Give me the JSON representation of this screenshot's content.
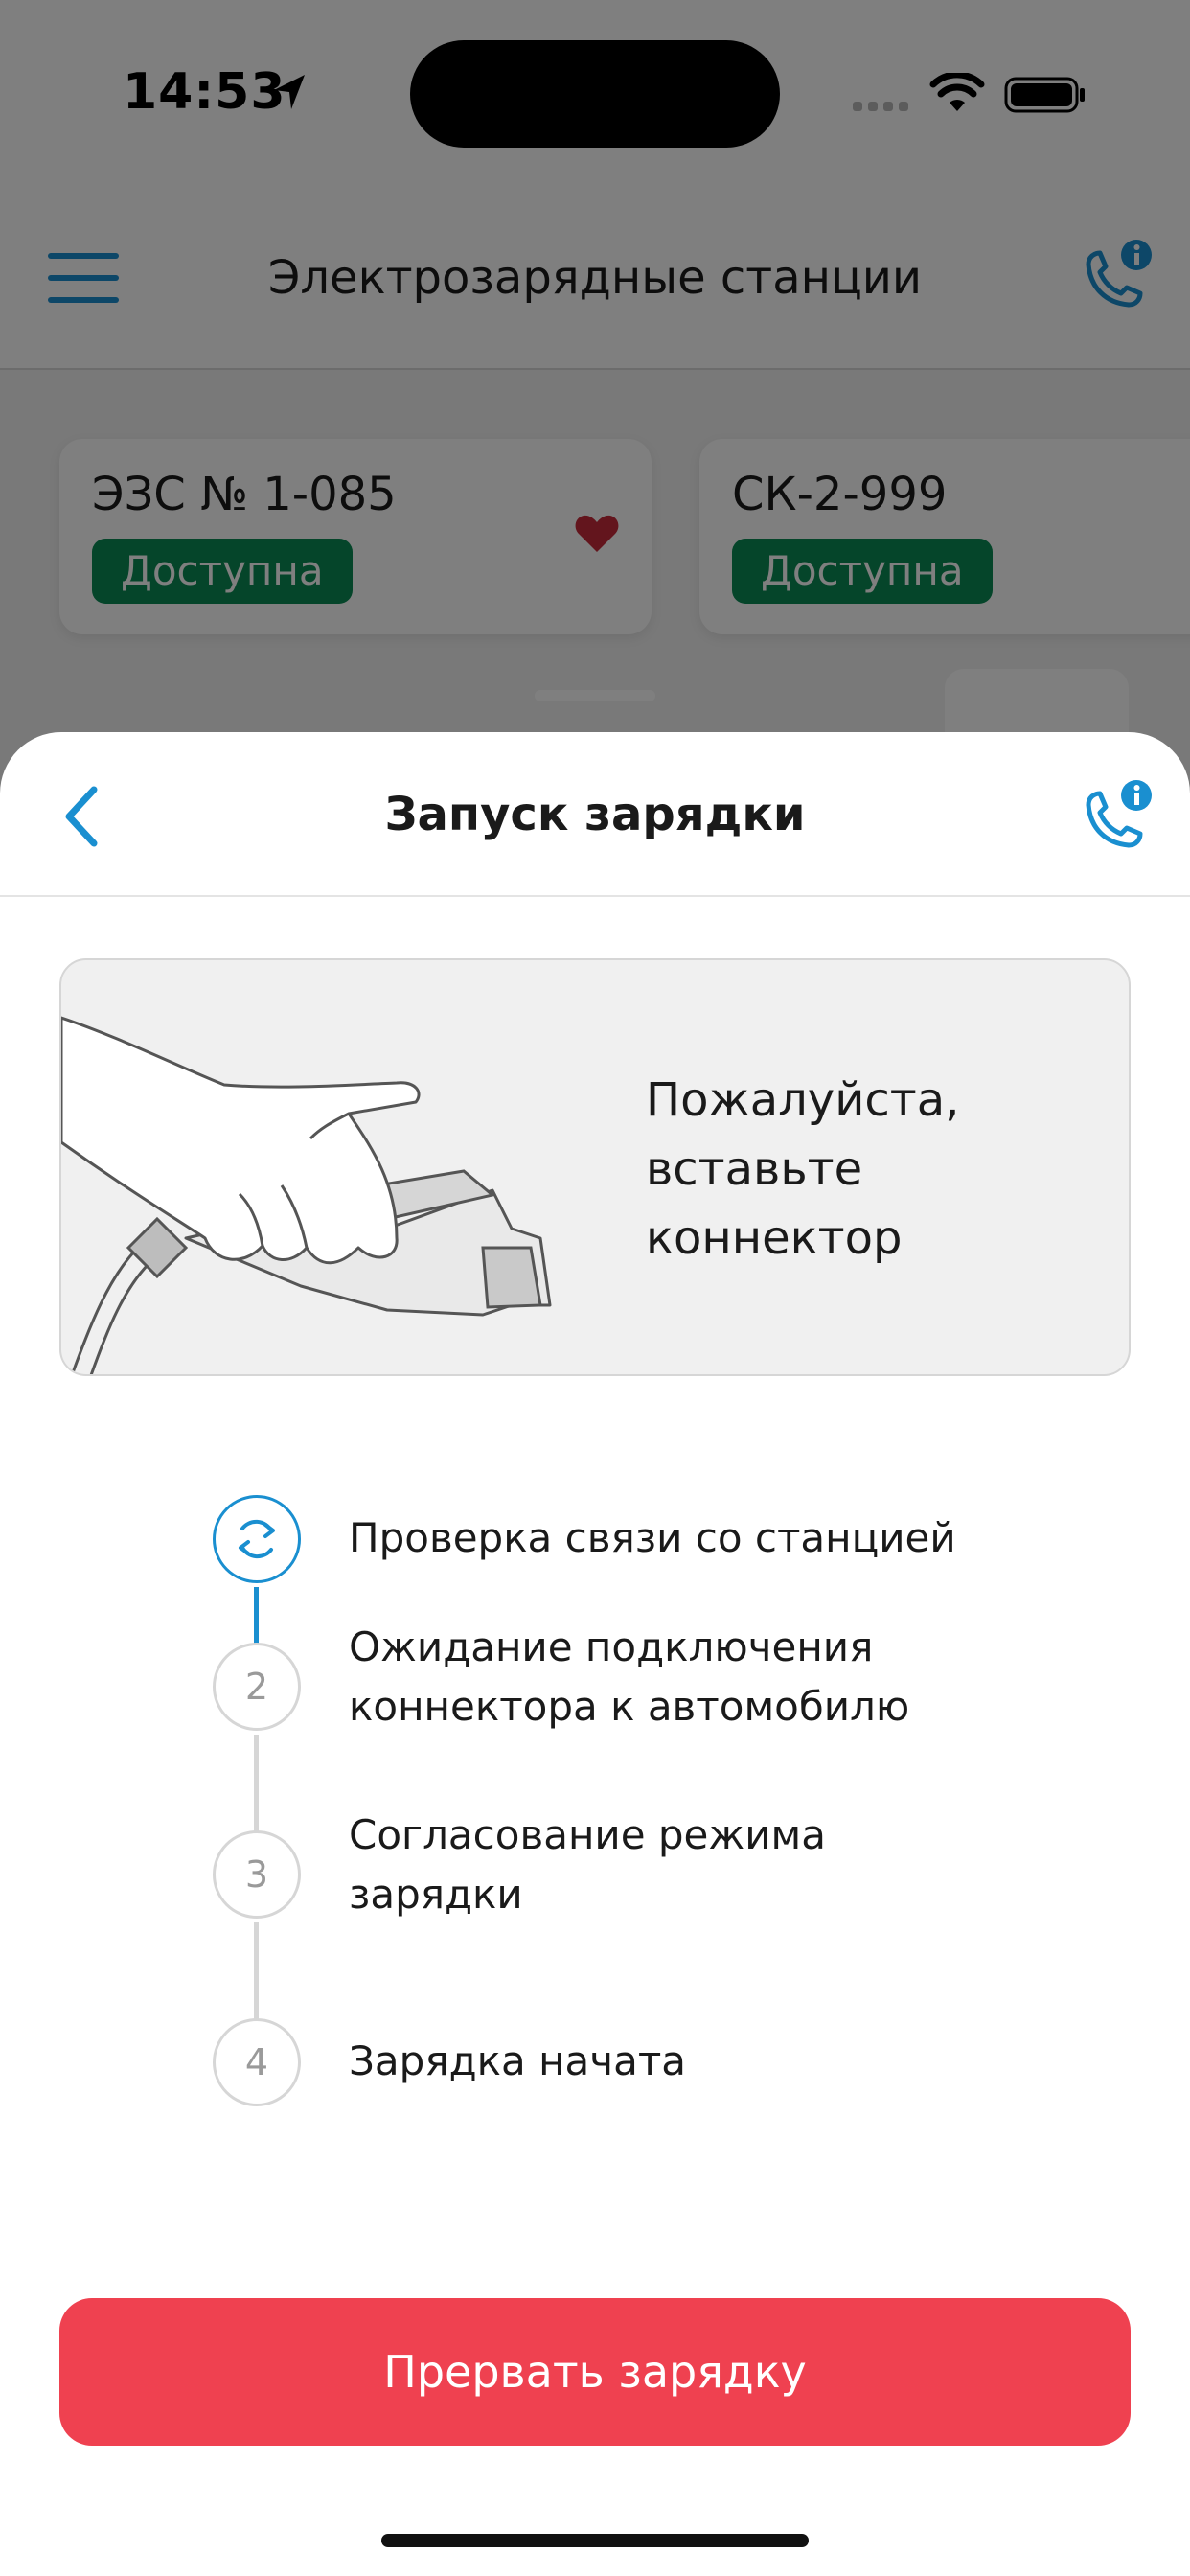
{
  "status_bar": {
    "time": "14:53"
  },
  "background_screen": {
    "header": {
      "title": "Электрозарядные станции"
    },
    "stations": [
      {
        "title": "ЭЗС № 1-085",
        "status": "Доступна",
        "favorite": true
      },
      {
        "title": "СК-2-999",
        "status": "Доступна",
        "favorite": false
      }
    ]
  },
  "sheet": {
    "title": "Запуск зарядки",
    "illustration_text": "Пожалуйста,\nвставьте\nконнектор",
    "steps": [
      {
        "number": "",
        "label": "Проверка связи со станцией",
        "state": "active",
        "icon": "refresh-icon"
      },
      {
        "number": "2",
        "label": "Ожидание подключения\nконнектора к автомобилю",
        "state": "pending"
      },
      {
        "number": "3",
        "label": "Согласование режима\nзарядки",
        "state": "pending"
      },
      {
        "number": "4",
        "label": "Зарядка начата",
        "state": "pending"
      }
    ],
    "stop_button_label": "Прервать зарядку"
  },
  "colors": {
    "accent": "#1a8fd0",
    "available_badge": "#0a8a55",
    "danger_button": "#ef4150",
    "favorite": "#c62b3a"
  }
}
